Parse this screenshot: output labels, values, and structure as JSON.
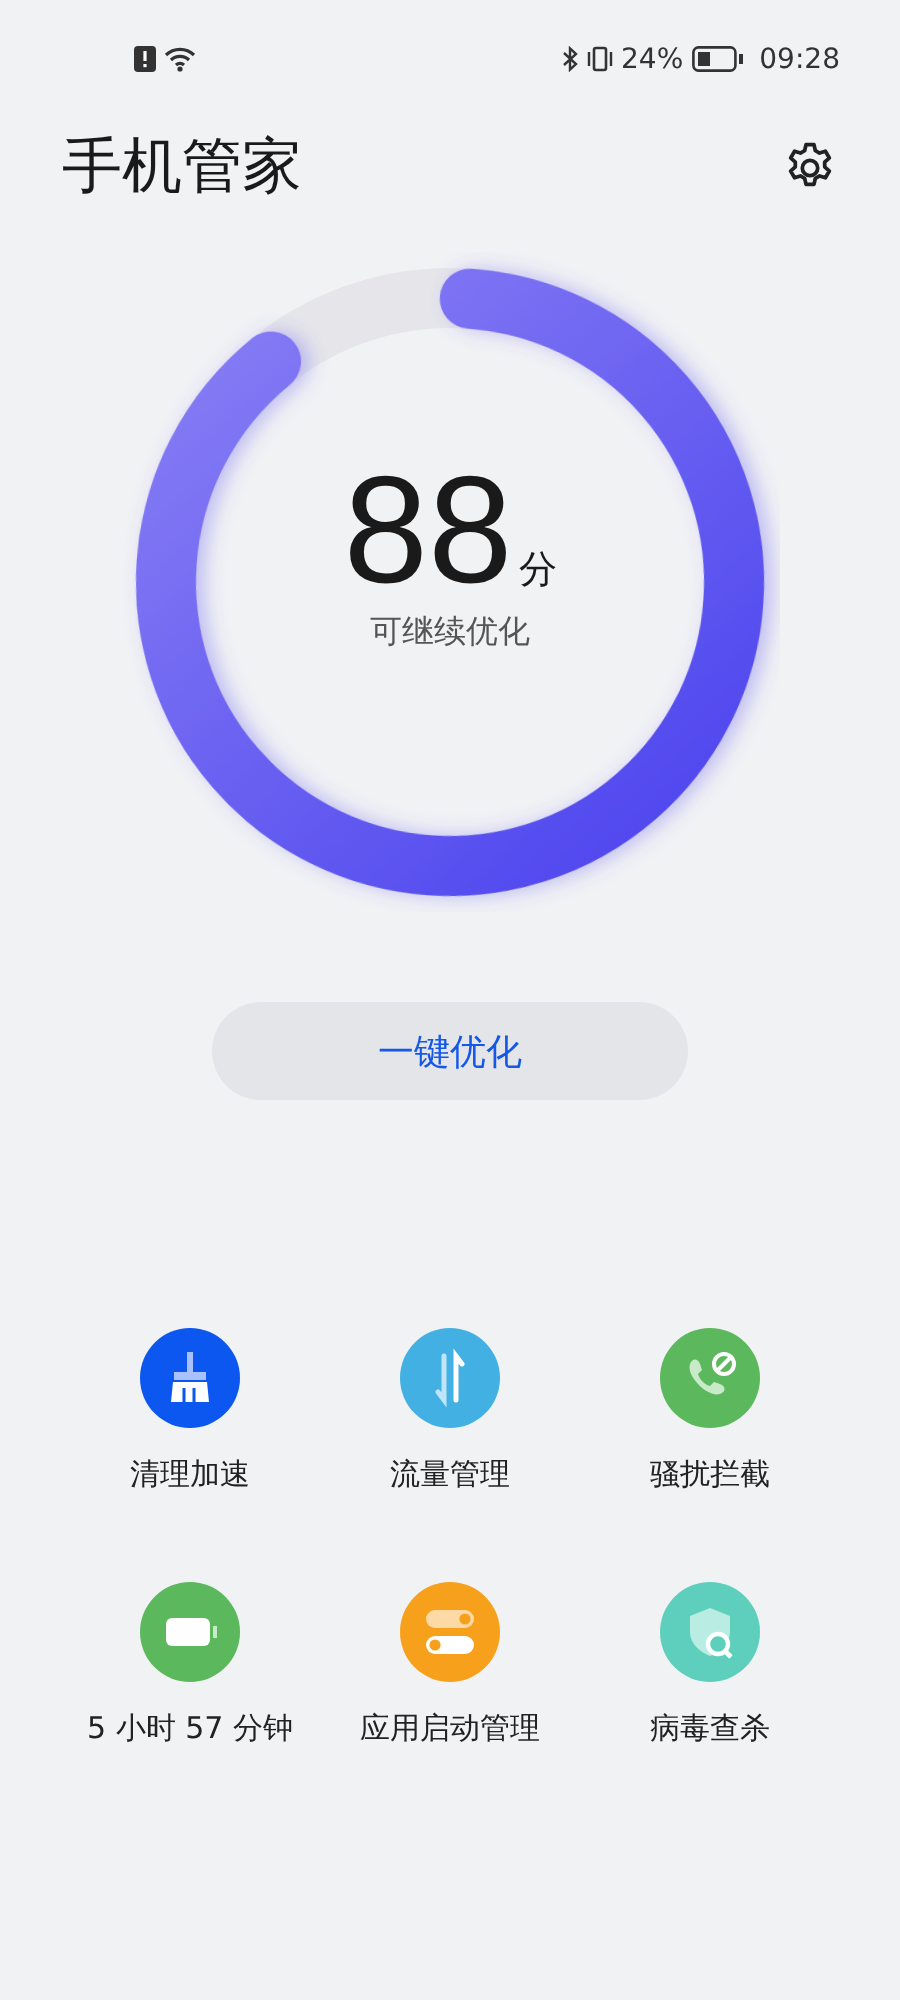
{
  "status_bar": {
    "battery": "24%",
    "time": "09:28"
  },
  "header": {
    "title": "手机管家"
  },
  "score": {
    "value": "88",
    "unit": "分",
    "caption": "可继续优化",
    "level": 0.88
  },
  "optimize_button": {
    "label": "一键优化"
  },
  "tools": [
    {
      "kind": "broom",
      "label": "清理加速"
    },
    {
      "kind": "data",
      "label": "流量管理"
    },
    {
      "kind": "block",
      "label": "骚扰拦截"
    },
    {
      "kind": "battery",
      "label": "5 小时 57 分钟"
    },
    {
      "kind": "startup",
      "label": "应用启动管理"
    },
    {
      "kind": "virus",
      "label": "病毒查杀"
    }
  ]
}
